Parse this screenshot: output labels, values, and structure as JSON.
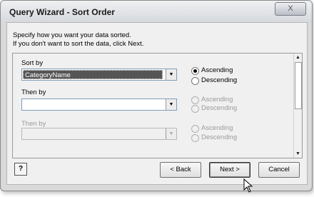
{
  "window": {
    "title": "Query Wizard - Sort Order",
    "close_glyph": "X"
  },
  "instructions": {
    "line1": "Specify how you want your data sorted.",
    "line2": "If you don't want to sort the data, click Next."
  },
  "sort_by": {
    "label": "Sort by",
    "value": "CategoryName",
    "ascending_label": "Ascending",
    "descending_label": "Descending",
    "selected": "Ascending"
  },
  "then_by_1": {
    "label": "Then by",
    "value": "",
    "ascending_label": "Ascending",
    "descending_label": "Descending"
  },
  "then_by_2": {
    "label": "Then by",
    "value": "",
    "ascending_label": "Ascending",
    "descending_label": "Descending"
  },
  "footer": {
    "help_glyph": "?",
    "back_label": "< Back",
    "next_label": "Next >",
    "cancel_label": "Cancel"
  },
  "icons": {
    "dropdown": "chevron-down-icon",
    "scroll_up": "scroll-up-icon",
    "scroll_down": "scroll-down-icon",
    "cursor": "mouse-pointer-icon"
  }
}
